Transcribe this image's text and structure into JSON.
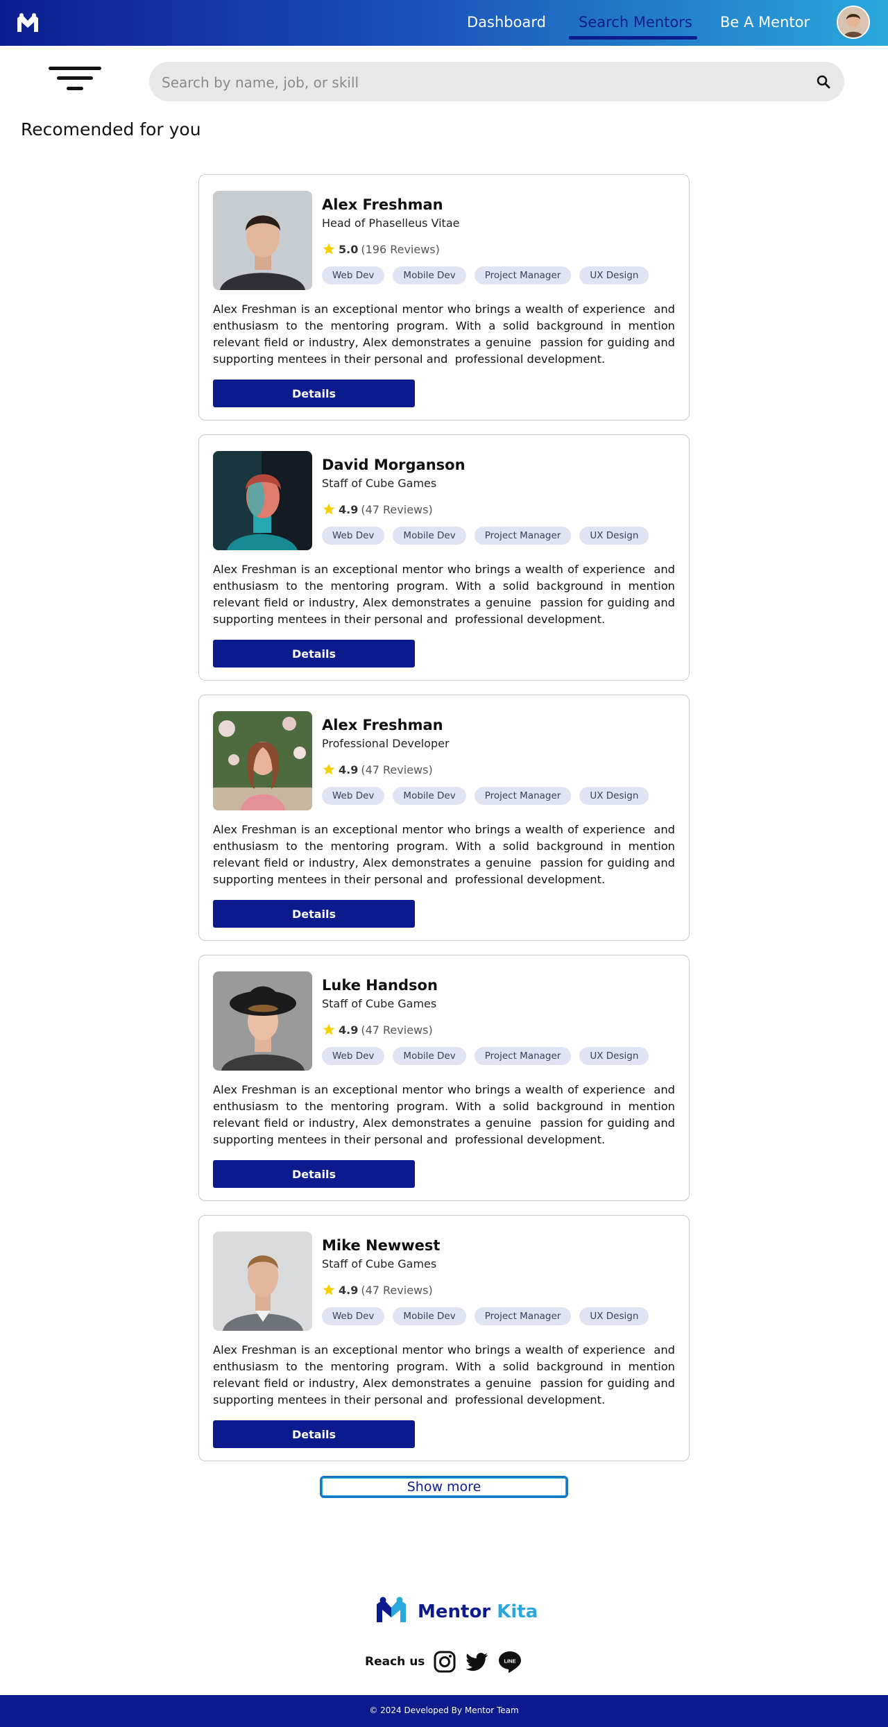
{
  "nav": {
    "links": [
      "Dashboard",
      "Search Mentors",
      "Be A Mentor"
    ]
  },
  "search": {
    "placeholder": "Search by name, job, or skill"
  },
  "section_title": "Recomended for you",
  "mentors": [
    {
      "name": "Alex Freshman",
      "role": "Head of Phaselleus Vitae",
      "rating": "5.0",
      "reviews": "(196 Reviews)",
      "tags": [
        "Web Dev",
        "Mobile Dev",
        "Project Manager",
        "UX Design"
      ],
      "description": "Alex Freshman is an exceptional mentor who brings a wealth of experience  and enthusiasm to the mentoring program. With a solid background in mention relevant field or industry, Alex demonstrates a genuine  passion for guiding and supporting mentees in their personal and  professional development.",
      "button": "Details"
    },
    {
      "name": "David Morganson",
      "role": "Staff of Cube Games",
      "rating": "4.9",
      "reviews": "(47 Reviews)",
      "tags": [
        "Web Dev",
        "Mobile Dev",
        "Project Manager",
        "UX Design"
      ],
      "description": "Alex Freshman is an exceptional mentor who brings a wealth of experience  and enthusiasm to the mentoring program. With a solid background in mention relevant field or industry, Alex demonstrates a genuine  passion for guiding and supporting mentees in their personal and  professional development.",
      "button": "Details"
    },
    {
      "name": "Alex Freshman",
      "role": "Professional Developer",
      "rating": "4.9",
      "reviews": "(47 Reviews)",
      "tags": [
        "Web Dev",
        "Mobile Dev",
        "Project Manager",
        "UX Design"
      ],
      "description": "Alex Freshman is an exceptional mentor who brings a wealth of experience  and enthusiasm to the mentoring program. With a solid background in mention relevant field or industry, Alex demonstrates a genuine  passion for guiding and supporting mentees in their personal and  professional development.",
      "button": "Details"
    },
    {
      "name": "Luke Handson",
      "role": "Staff of Cube Games",
      "rating": "4.9",
      "reviews": "(47 Reviews)",
      "tags": [
        "Web Dev",
        "Mobile Dev",
        "Project Manager",
        "UX Design"
      ],
      "description": "Alex Freshman is an exceptional mentor who brings a wealth of experience  and enthusiasm to the mentoring program. With a solid background in mention relevant field or industry, Alex demonstrates a genuine  passion for guiding and supporting mentees in their personal and  professional development.",
      "button": "Details"
    },
    {
      "name": "Mike Newwest",
      "role": "Staff of Cube Games",
      "rating": "4.9",
      "reviews": "(47 Reviews)",
      "tags": [
        "Web Dev",
        "Mobile Dev",
        "Project Manager",
        "UX Design"
      ],
      "description": "Alex Freshman is an exceptional mentor who brings a wealth of experience  and enthusiasm to the mentoring program. With a solid background in mention relevant field or industry, Alex demonstrates a genuine  passion for guiding and supporting mentees in their personal and  professional development.",
      "button": "Details"
    }
  ],
  "show_more": "Show more",
  "footer": {
    "brand_part1": "Mentor",
    "brand_part2": "Kita",
    "reach_us": "Reach us",
    "copyright": "© 2024 Developed By Mentor Team",
    "social_icons": [
      "instagram-icon",
      "twitter-icon",
      "line-icon"
    ]
  },
  "colors": {
    "primary": "#0b1a8c",
    "accent": "#2aa7db",
    "tag_bg": "#dfe3f2",
    "star": "#f5d000"
  }
}
